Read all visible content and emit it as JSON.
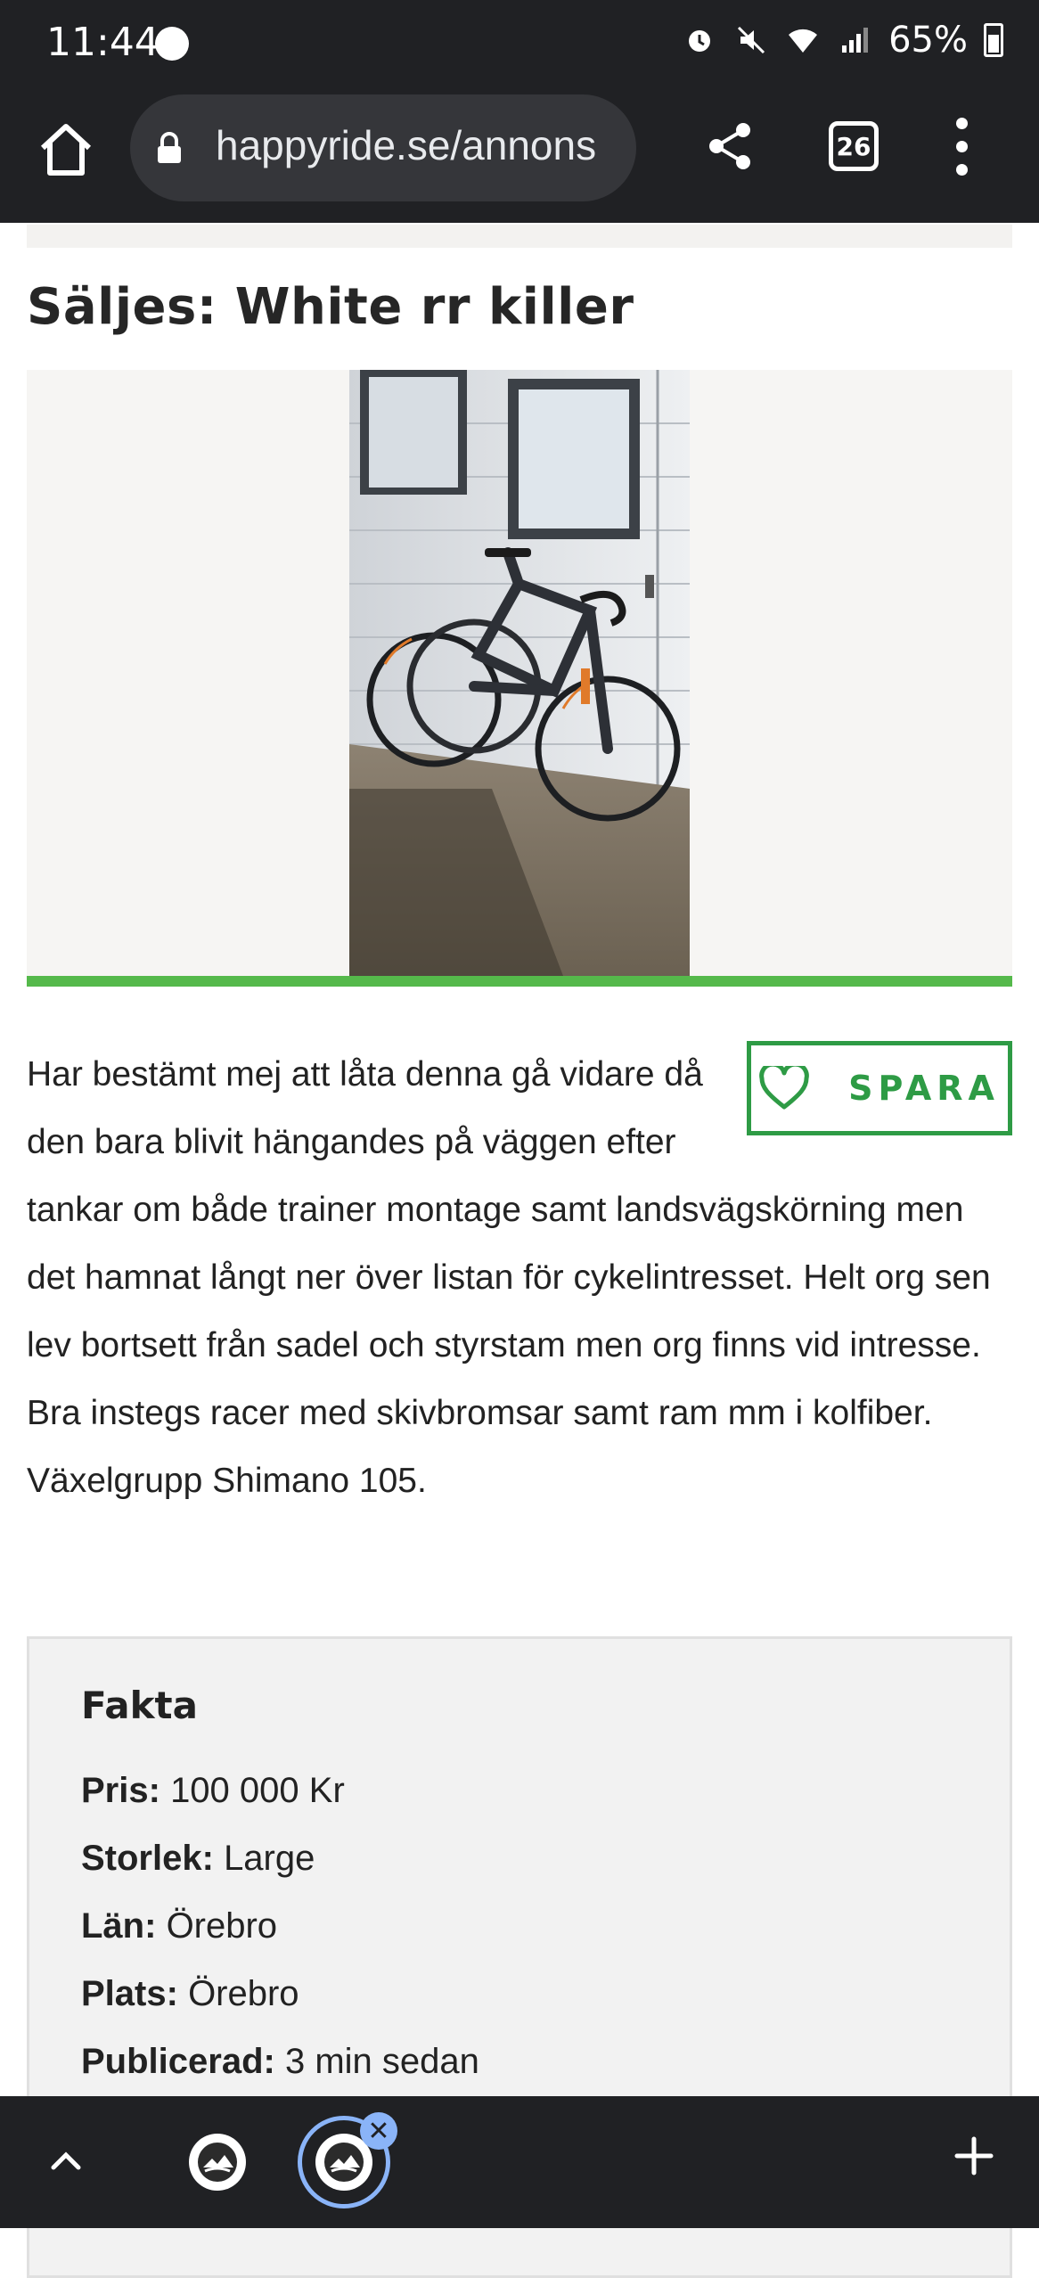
{
  "status_bar": {
    "time": "11:44",
    "battery": "65%"
  },
  "browser": {
    "url": "happyride.se/annons",
    "tab_count": "26"
  },
  "listing": {
    "title": "Säljes: White rr killer",
    "save_label": "SPARA",
    "description_lines": [
      "Har bestämt mej att låta denna gå vidare då den bara blivit hängandes på väggen efter tankar om både trainer montage samt landsvägskörning men det hamnat långt ner över listan för cykelintresset. Helt org sen lev bortsett från sadel och styrstam men org finns vid intresse. Bra instegs racer med skivbromsar samt ram mm i kolfiber.",
      "Växelgrupp Shimano 105."
    ]
  },
  "facts": {
    "heading": "Fakta",
    "rows": [
      {
        "label": "Pris:",
        "value": "100 000 Kr"
      },
      {
        "label": "Storlek:",
        "value": "Large"
      },
      {
        "label": "Län:",
        "value": "Örebro"
      },
      {
        "label": "Plats:",
        "value": "Örebro"
      },
      {
        "label": "Publicerad:",
        "value": "3 min sedan"
      }
    ]
  },
  "colors": {
    "accent_green": "#2e9b45",
    "bar_green": "#55b94b",
    "chrome_dark": "#202124",
    "tab_highlight": "#8ab4f8"
  },
  "icons": {
    "home": "home-icon",
    "lock": "lock-icon",
    "share": "share-icon",
    "menu": "more-vert-icon",
    "heart": "heart-outline-icon",
    "up": "chevron-up-icon",
    "close": "close-icon",
    "add": "plus-icon"
  }
}
